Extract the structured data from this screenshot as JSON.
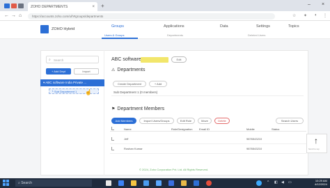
{
  "browser": {
    "tab_title": "ZOHO DEPARTMENTS",
    "tab_close": "×",
    "new_tab": "+",
    "url": "https://accounts.zoho.com/u/h#groups/departments",
    "minimize": "–",
    "close": "×"
  },
  "header": {
    "org_name": "ZOHO Hybrid",
    "nav": [
      {
        "label": "Groups"
      },
      {
        "label": "Applications"
      },
      {
        "label": "Data"
      },
      {
        "label": "Settings"
      },
      {
        "label": "Topics"
      }
    ],
    "subnav": [
      {
        "label": "Users & Groups"
      },
      {
        "label": "Departments"
      },
      {
        "label": "Deleted Users"
      }
    ]
  },
  "left_panel": {
    "search_placeholder": "Search",
    "add_button": "+ Add Dept",
    "import_button": "Import",
    "tree_selected": "▾ ABC software India Private ...",
    "tree_sub": "└ Sub Department 1"
  },
  "department": {
    "name": "ABC software",
    "edit_label": "Edit",
    "section_sub_title": "Departments",
    "subdept_actions": [
      "Create Department",
      "+ Add"
    ],
    "subdept_row": "Sub Department 1 (0 members)",
    "section_members_title": "Department Members",
    "member_actions": [
      {
        "label": "Add Members",
        "style": "blue"
      },
      {
        "label": "Import Users/Groups",
        "style": "grey"
      },
      {
        "label": "Edit Role",
        "style": "grey"
      },
      {
        "label": "Move",
        "style": "grey"
      },
      {
        "label": "Delete",
        "style": "red"
      },
      {
        "label": "Search Users",
        "style": "grey"
      }
    ],
    "table": {
      "headers": [
        "Name",
        "Role/Designation",
        "Email ID",
        "Mobile",
        "Status"
      ],
      "rows": [
        {
          "name": "Jeff",
          "mobile": "9876543210"
        },
        {
          "name": "Roshan Kumar",
          "mobile": "9876543210"
        }
      ]
    }
  },
  "footer_note": "© 2024, Zoho Corporation Pvt. Ltd. All Rights Reserved.",
  "side_widget": {
    "arrow": "↑",
    "label": "Scroll to top"
  },
  "taskbar": {
    "search_text": "Search",
    "clock_time": "10:29 AM",
    "clock_date": "4/12/2024"
  },
  "colors": {
    "accent": "#2c6fd6",
    "taskbar": "#1f2b3d",
    "badge": "#f2e66b"
  }
}
